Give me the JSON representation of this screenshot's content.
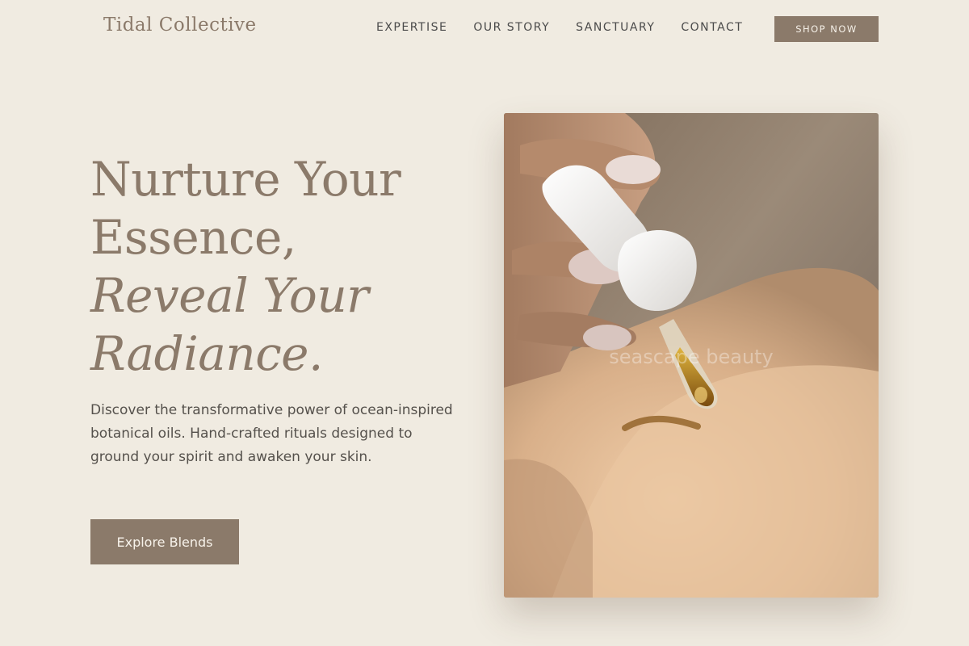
{
  "header": {
    "logo": "Tidal Collective",
    "nav": [
      "EXPERTISE",
      "OUR STORY",
      "SANCTUARY",
      "CONTACT"
    ],
    "shop_label": "SHOP NOW"
  },
  "hero": {
    "title_line1": "Nurture Your",
    "title_line2": "Essence,",
    "title_line3": "Reveal Your",
    "title_line4": "Radiance.",
    "description": "Discover the transformative power of ocean-inspired botanical oils. Hand-crafted rituals designed to ground your spirit and awaken your skin.",
    "cta_label": "Explore Blends"
  },
  "image": {
    "watermark": "seascape beauty"
  },
  "colors": {
    "background": "#f0ebe1",
    "accent": "#8b7a6a",
    "text": "#55514c"
  }
}
